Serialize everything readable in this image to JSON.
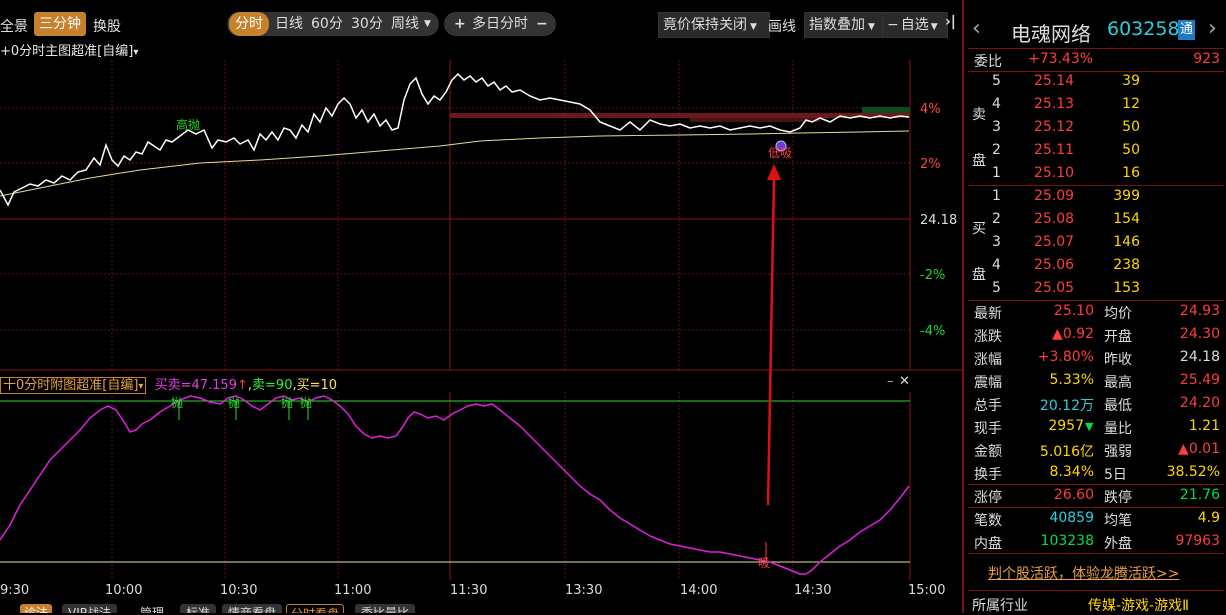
{
  "toolbar": {
    "quanjing": "全景",
    "sanfenzhong": "三分钟",
    "huangu": "换股",
    "fenshi": "分时",
    "rixian": "日线",
    "min60": "60分",
    "min30": "30分",
    "zhouxian": "周线",
    "plus": "+",
    "duori": "多日分时",
    "minus": "−",
    "jingjia": "竟价保持关闭",
    "huaxian": "画线",
    "zhishu": "指数叠加",
    "zixuan": "自选",
    "close": "✕"
  },
  "main_chart": {
    "title": "+0分时主图超准[自编]",
    "title_arrow": "▾",
    "label_gaoxi": "高抛",
    "label_dixi": "低吸",
    "pct_labels": [
      "4%",
      "2%",
      "24.18",
      "-2%",
      "-4%"
    ]
  },
  "sub_chart": {
    "title": "十0分时附图超准[自编]",
    "title_arrow": "▾",
    "formula": "买卖=47.159",
    "formula_arrow": "↑",
    "sell": "卖=90",
    "buy": "买=10",
    "pao_labels": [
      "抛",
      "抛",
      "抛",
      "抛"
    ],
    "xi_label": "吸",
    "minimize": "–",
    "close": "✕"
  },
  "time_axis": [
    "9:30",
    "10:00",
    "10:30",
    "11:00",
    "11:30",
    "13:30",
    "14:00",
    "14:30",
    "15:00"
  ],
  "bottom_tabs": [
    "诊法",
    "VIP战法",
    "管理",
    "标准",
    "情商看盘",
    "分时看盘",
    "委比量比"
  ],
  "stock": {
    "name": "电魂网络",
    "code": "603258",
    "badge": "通",
    "nav_left": "‹",
    "nav_right": "›"
  },
  "weibi": {
    "label": "委比",
    "pct": "+73.43%",
    "value": "923"
  },
  "sell_side": {
    "label": "卖盘",
    "rows": [
      {
        "level": "5",
        "price": "25.14",
        "vol": "39"
      },
      {
        "level": "4",
        "price": "25.13",
        "vol": "12"
      },
      {
        "level": "3",
        "price": "25.12",
        "vol": "50"
      },
      {
        "level": "2",
        "price": "25.11",
        "vol": "50"
      },
      {
        "level": "1",
        "price": "25.10",
        "vol": "16"
      }
    ]
  },
  "buy_side": {
    "label": "买盘",
    "rows": [
      {
        "level": "1",
        "price": "25.09",
        "vol": "399"
      },
      {
        "level": "2",
        "price": "25.08",
        "vol": "154"
      },
      {
        "level": "3",
        "price": "25.07",
        "vol": "146"
      },
      {
        "level": "4",
        "price": "25.06",
        "vol": "238"
      },
      {
        "level": "5",
        "price": "25.05",
        "vol": "153"
      }
    ]
  },
  "quote": [
    {
      "l1": "最新",
      "v1": "25.10",
      "l2": "均价",
      "v2": "24.93"
    },
    {
      "l1": "涨跌",
      "v1": "▲0.92",
      "l2": "开盘",
      "v2": "24.30"
    },
    {
      "l1": "涨幅",
      "v1": "+3.80%",
      "l2": "昨收",
      "v2": "24.18"
    },
    {
      "l1": "震幅",
      "v1": "5.33%",
      "l2": "最高",
      "v2": "25.49"
    },
    {
      "l1": "总手",
      "v1": "20.12万",
      "l2": "最低",
      "v2": "24.20"
    },
    {
      "l1": "现手",
      "v1": "2957",
      "v1b": "▼",
      "l2": "量比",
      "v2": "1.21"
    },
    {
      "l1": "金额",
      "v1": "5.016亿",
      "l2": "强弱",
      "v2": "▲0.01"
    },
    {
      "l1": "换手",
      "v1": "8.34%",
      "l2": "5日",
      "v2": "38.52%"
    },
    {
      "l1": "涨停",
      "v1": "26.60",
      "l2": "跌停",
      "v2": "21.76"
    },
    {
      "l1": "笔数",
      "v1": "40859",
      "l2": "均笔",
      "v2": "4.9"
    },
    {
      "l1": "内盘",
      "v1": "103238",
      "l2": "外盘",
      "v2": "97963"
    }
  ],
  "promo": "判个股活跃，体验龙腾活跃>>",
  "industry": {
    "label": "所属行业",
    "value": "传媒-游戏-游戏Ⅱ"
  },
  "colors": {
    "up": "#ff3c3c",
    "down": "#00e040",
    "accent": "#c7802b",
    "grid": "#7a1010"
  }
}
